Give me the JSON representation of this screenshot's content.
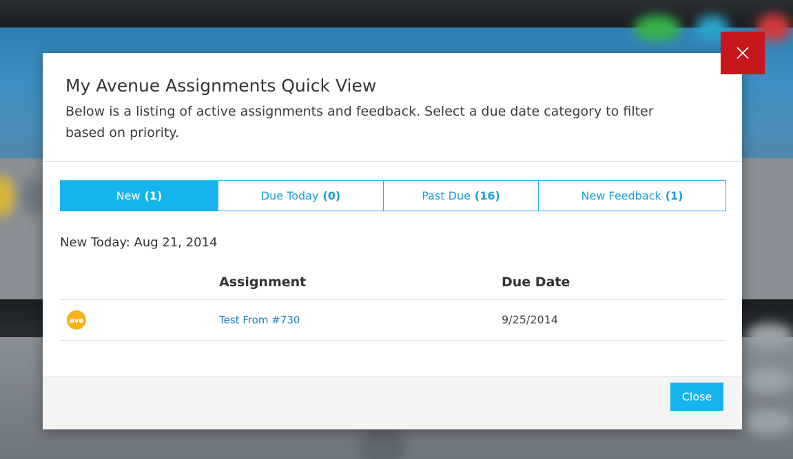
{
  "modal": {
    "title": "My Avenue Assignments Quick View",
    "description": "Below is a listing of active assignments and feedback. Select a due date category to filter based on priority."
  },
  "tabs": [
    {
      "label": "New",
      "count": "(1)",
      "active": true
    },
    {
      "label": "Due Today",
      "count": "(0)",
      "active": false
    },
    {
      "label": "Past Due",
      "count": "(16)",
      "active": false
    },
    {
      "label": "New Feedback",
      "count": "(1)",
      "active": false
    }
  ],
  "section": {
    "date_heading": "New Today: Aug 21, 2014"
  },
  "table": {
    "headers": {
      "assignment": "Assignment",
      "due_date": "Due Date"
    },
    "rows": [
      {
        "logo_text": "ave",
        "assignment": "Test From #730",
        "due_date": "9/25/2014"
      }
    ]
  },
  "footer": {
    "close_label": "Close"
  },
  "colors": {
    "accent": "#15b4ec",
    "close_x_bg": "#c8161d",
    "logo": "#f5b417",
    "link": "#1c7fc4"
  },
  "icons": {
    "modal_close": "close-icon",
    "row_logo": "ave-logo"
  }
}
